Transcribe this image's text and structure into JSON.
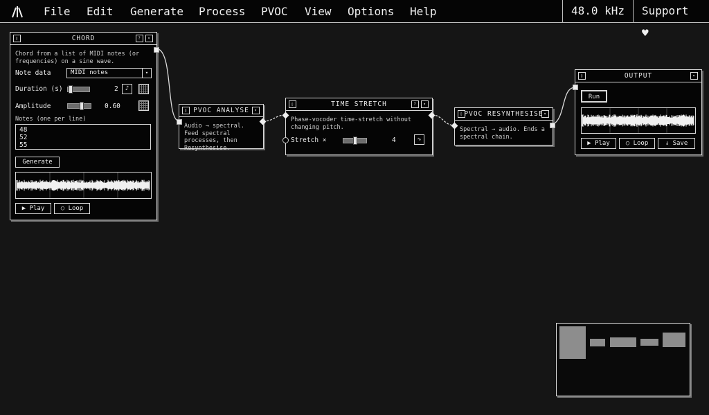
{
  "menu": {
    "items": [
      "File",
      "Edit",
      "Generate",
      "Process",
      "PVOC",
      "View",
      "Options",
      "Help"
    ],
    "sample_rate": "48.0 kHz",
    "support": "Support ♥"
  },
  "chord": {
    "title": "CHORD",
    "description": "Chord from a list of MIDI notes (or frequencies) on a sine wave.",
    "note_data_label": "Note data",
    "note_data_value": "MIDI notes",
    "duration_label": "Duration (s)",
    "duration_value": "2",
    "amplitude_label": "Amplitude",
    "amplitude_value": "0.60",
    "notes_label": "Notes (one per line)",
    "notes": [
      "48",
      "52",
      "55"
    ],
    "generate_label": "Generate",
    "play_label": "▶ Play",
    "loop_label": "○ Loop"
  },
  "pvoc_analyse": {
    "title": "PVOC ANALYSE",
    "description": "Audio → spectral. Feed spectral processes, then Resynthesise."
  },
  "time_stretch": {
    "title": "TIME STRETCH",
    "description": "Phase-vocoder time-stretch without changing pitch.",
    "stretch_label": "Stretch ×",
    "stretch_value": "4"
  },
  "pvoc_resynth": {
    "title": "PVOC RESYNTHESISE",
    "description": "Spectral → audio. Ends a spectral chain."
  },
  "output": {
    "title": "OUTPUT",
    "run_label": "Run",
    "play_label": "▶ Play",
    "loop_label": "○ Loop",
    "save_label": "↓ Save"
  },
  "icons": {
    "help": "?",
    "menu": "▾",
    "note": "♪"
  }
}
